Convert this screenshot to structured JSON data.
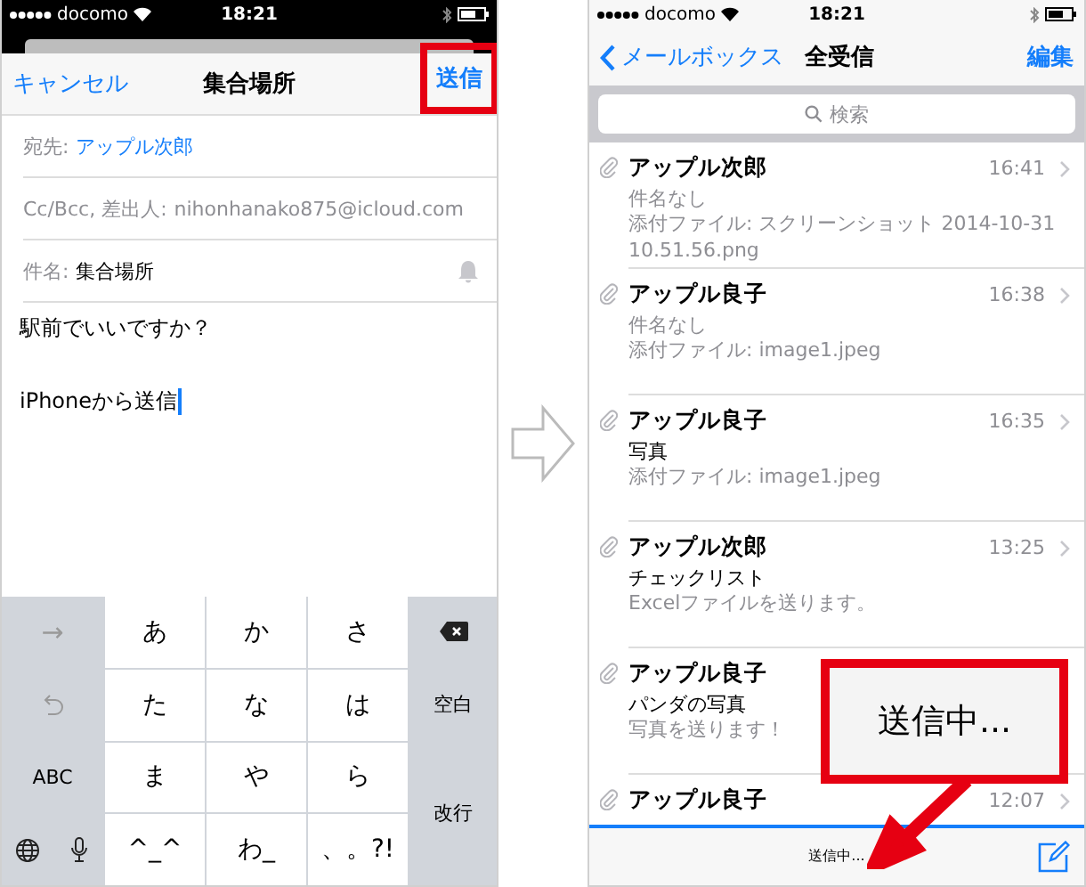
{
  "compose": {
    "status_bar": {
      "carrier": "docomo",
      "time": "18:21"
    },
    "nav": {
      "cancel": "キャンセル",
      "title": "集合場所",
      "send": "送信",
      "send_highlighted": true
    },
    "fields": [
      {
        "label": "宛先:",
        "value": "アップル次郎",
        "kind": "recipient"
      },
      {
        "label": "Cc/Bcc, 差出人:",
        "value": "nihonhanako875@icloud.com",
        "kind": "plain"
      },
      {
        "label": "件名:",
        "value": "集合場所",
        "kind": "subject"
      }
    ],
    "body_lines": [
      "駅前でいいですか？",
      "iPhoneから送信"
    ],
    "keyboard": [
      [
        {
          "kind": "arrow",
          "label": "→"
        },
        {
          "kind": "char",
          "label": "あ"
        },
        {
          "kind": "char",
          "label": "か"
        },
        {
          "kind": "char",
          "label": "さ"
        },
        {
          "kind": "delete"
        }
      ],
      [
        {
          "kind": "undo"
        },
        {
          "kind": "char",
          "label": "た"
        },
        {
          "kind": "char",
          "label": "な"
        },
        {
          "kind": "char",
          "label": "は"
        },
        {
          "kind": "func",
          "label": "空白"
        }
      ],
      [
        {
          "kind": "func",
          "label": "ABC"
        },
        {
          "kind": "char",
          "label": "ま"
        },
        {
          "kind": "char",
          "label": "や"
        },
        {
          "kind": "char",
          "label": "ら"
        },
        {
          "kind": "return",
          "label": "改行"
        }
      ],
      [
        {
          "kind": "globe"
        },
        {
          "kind": "mic"
        },
        {
          "kind": "char",
          "label": "^_^"
        },
        {
          "kind": "char",
          "label": "わ_"
        },
        {
          "kind": "char",
          "label": "、。?!"
        }
      ]
    ]
  },
  "inbox": {
    "status_bar": {
      "carrier": "docomo",
      "time": "18:21"
    },
    "nav": {
      "back": "メールボックス",
      "title": "全受信",
      "edit": "編集"
    },
    "search": {
      "placeholder": "検索"
    },
    "messages": [
      {
        "sender": "アップル次郎",
        "time": "16:41",
        "subject": "件名なし",
        "subject_missing": true,
        "preview": "添付ファイル: スクリーンショット 2014-10-31 10.51.56.png",
        "attachment": true
      },
      {
        "sender": "アップル良子",
        "time": "16:38",
        "subject": "件名なし",
        "subject_missing": true,
        "preview": "添付ファイル: image1.jpeg",
        "attachment": true
      },
      {
        "sender": "アップル良子",
        "time": "16:35",
        "subject": "写真",
        "subject_missing": false,
        "preview": "添付ファイル: image1.jpeg",
        "attachment": true
      },
      {
        "sender": "アップル次郎",
        "time": "13:25",
        "subject": "チェックリスト",
        "subject_missing": false,
        "preview": "Excelファイルを送ります。",
        "attachment": true
      },
      {
        "sender": "アップル良子",
        "subject": "パンダの写真",
        "subject_missing": false,
        "preview": "写真を送ります！",
        "attachment": true
      },
      {
        "sender": "アップル良子",
        "time": "12:07",
        "attachment": true
      }
    ],
    "toolbar": {
      "status": "送信中...",
      "progress": {
        "level": 1
      }
    }
  },
  "callout": {
    "text": "送信中..."
  }
}
